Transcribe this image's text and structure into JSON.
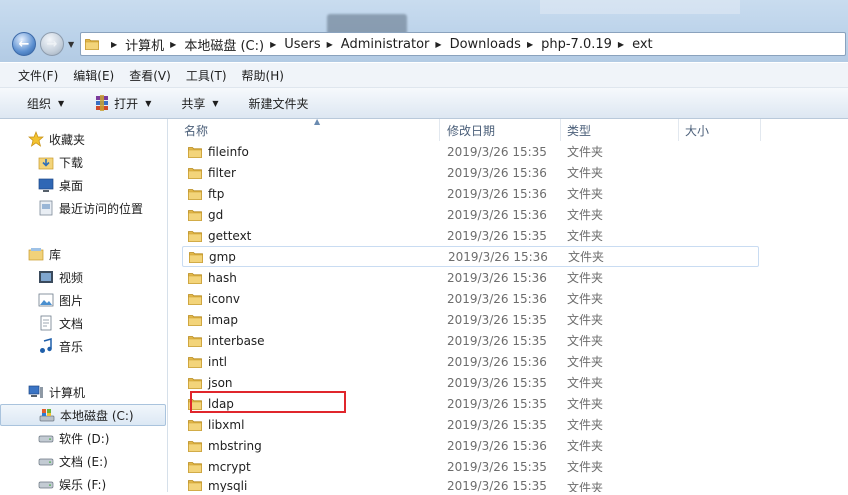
{
  "address": {
    "crumbs": [
      "计算机",
      "本地磁盘 (C:)",
      "Users",
      "Administrator",
      "Downloads",
      "php-7.0.19",
      "ext"
    ]
  },
  "menu": [
    "文件(F)",
    "编辑(E)",
    "查看(V)",
    "工具(T)",
    "帮助(H)"
  ],
  "toolbar": {
    "organize": "组织",
    "open": "打开",
    "share": "共享",
    "new_folder": "新建文件夹"
  },
  "nav": {
    "favorites": "收藏夹",
    "downloads": "下载",
    "desktop": "桌面",
    "recent": "最近访问的位置",
    "libraries": "库",
    "videos": "视频",
    "pictures": "图片",
    "documents": "文档",
    "music": "音乐",
    "computer": "计算机",
    "drive_c": "本地磁盘 (C:)",
    "drive_d": "软件 (D:)",
    "drive_e": "文档 (E:)",
    "drive_f": "娱乐 (F:)"
  },
  "columns": {
    "name": "名称",
    "date": "修改日期",
    "type": "类型",
    "size": "大小"
  },
  "files": [
    {
      "name": "fileinfo",
      "date": "2019/3/26 15:35",
      "type": "文件夹"
    },
    {
      "name": "filter",
      "date": "2019/3/26 15:36",
      "type": "文件夹"
    },
    {
      "name": "ftp",
      "date": "2019/3/26 15:36",
      "type": "文件夹"
    },
    {
      "name": "gd",
      "date": "2019/3/26 15:36",
      "type": "文件夹"
    },
    {
      "name": "gettext",
      "date": "2019/3/26 15:35",
      "type": "文件夹"
    },
    {
      "name": "gmp",
      "date": "2019/3/26 15:36",
      "type": "文件夹"
    },
    {
      "name": "hash",
      "date": "2019/3/26 15:36",
      "type": "文件夹"
    },
    {
      "name": "iconv",
      "date": "2019/3/26 15:36",
      "type": "文件夹"
    },
    {
      "name": "imap",
      "date": "2019/3/26 15:35",
      "type": "文件夹"
    },
    {
      "name": "interbase",
      "date": "2019/3/26 15:35",
      "type": "文件夹"
    },
    {
      "name": "intl",
      "date": "2019/3/26 15:36",
      "type": "文件夹"
    },
    {
      "name": "json",
      "date": "2019/3/26 15:35",
      "type": "文件夹"
    },
    {
      "name": "ldap",
      "date": "2019/3/26 15:35",
      "type": "文件夹"
    },
    {
      "name": "libxml",
      "date": "2019/3/26 15:35",
      "type": "文件夹"
    },
    {
      "name": "mbstring",
      "date": "2019/3/26 15:36",
      "type": "文件夹"
    },
    {
      "name": "mcrypt",
      "date": "2019/3/26 15:35",
      "type": "文件夹"
    },
    {
      "name": "mysqli",
      "date": "2019/3/26 15:35",
      "type": "文件夹"
    }
  ],
  "colors": {
    "highlight_box": "#e0262c",
    "folder_yellow": "#e8c35a"
  }
}
